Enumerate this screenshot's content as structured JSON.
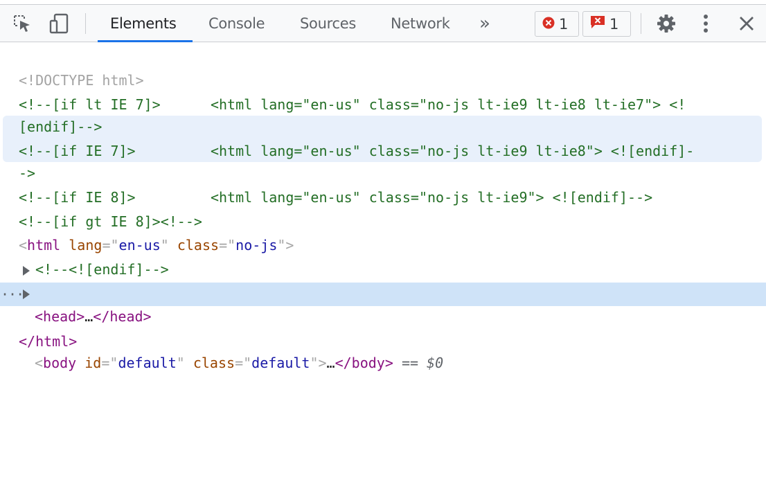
{
  "toolbar": {
    "icons": {
      "inspect": "inspect-element-icon",
      "device": "device-toolbar-icon",
      "settings": "gear-icon",
      "more": "kebab-menu-icon",
      "close": "close-icon"
    },
    "tabs": [
      {
        "label": "Elements",
        "active": true
      },
      {
        "label": "Console",
        "active": false
      },
      {
        "label": "Sources",
        "active": false
      },
      {
        "label": "Network",
        "active": false
      }
    ],
    "more_tabs": "»",
    "error_count": "1",
    "issue_count": "1"
  },
  "code": {
    "doctype": "<!DOCTYPE html>",
    "line1a": "<!--[if lt IE 7]>      <html lang=\"en-us\" class=\"no-js lt-ie9 lt-ie8 lt-ie7\"> <!",
    "line1b": "[endif]-->",
    "line2a": "<!--[if IE 7]>         <html lang=\"en-us\" class=\"no-js lt-ie9 lt-ie8\"> <![endif]-",
    "line2b": "->",
    "line3": "<!--[if IE 8]>         <html lang=\"en-us\" class=\"no-js lt-ie9\"> <![endif]-->",
    "line4": "<!--[if gt IE 8]><!-->",
    "html_open": {
      "lt": "<",
      "tag": "html",
      "attr1": "lang",
      "eq": "=",
      "q": "\"",
      "val1": "en-us",
      "attr2": "class",
      "val2": "no-js",
      "gt": ">"
    },
    "endif_comment": "<!--<![endif]-->",
    "head": {
      "open": "<head>",
      "ellipsis": "…",
      "close": "</head>"
    },
    "body": {
      "lt": "<",
      "tag": "body",
      "attr1": "id",
      "val1": "default",
      "attr2": "class",
      "val2": "default",
      "ellipsis": "…",
      "close": "</body>",
      "marker": "== $0"
    },
    "html_close": "</html>",
    "row_dots": "···"
  },
  "colors": {
    "accent": "#1a73e8",
    "error": "#d93025",
    "comment": "#236e25",
    "tag": "#881280",
    "attr": "#994500",
    "value": "#1a1aa6",
    "selected_row": "#cfe3f8",
    "hover_row": "#e8f0fb"
  }
}
